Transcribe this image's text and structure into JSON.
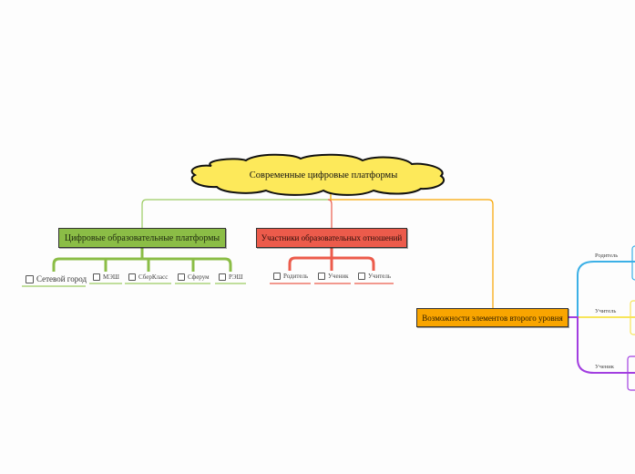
{
  "central_topic": {
    "label": "Современные цифровые платформы",
    "fill_color": "#fde95a",
    "shape": "cloud"
  },
  "topics": [
    {
      "label": "Цифровые образовательные платформы",
      "color": "#8bbd46",
      "subtopics": [
        {
          "label": "Сетевой город",
          "checkbox": true
        },
        {
          "label": "МЭШ",
          "checkbox": true
        },
        {
          "label": "СберКласс",
          "checkbox": true
        },
        {
          "label": "Сферум",
          "checkbox": true
        },
        {
          "label": "РЭШ",
          "checkbox": true
        }
      ]
    },
    {
      "label": "Участники образовательных отношений",
      "color": "#ec5b4b",
      "subtopics": [
        {
          "label": "Родитель",
          "checkbox": true
        },
        {
          "label": "Ученик",
          "checkbox": true
        },
        {
          "label": "Учитель",
          "checkbox": true
        }
      ]
    },
    {
      "label": "Возможности элементов второго уровня",
      "color": "#f9a500",
      "subtopics": [
        {
          "label": "Родитель",
          "color": "#3cb0e6"
        },
        {
          "label": "Учитель",
          "color": "#f7e55a"
        },
        {
          "label": "Ученик",
          "color": "#a23ee0"
        }
      ]
    }
  ]
}
